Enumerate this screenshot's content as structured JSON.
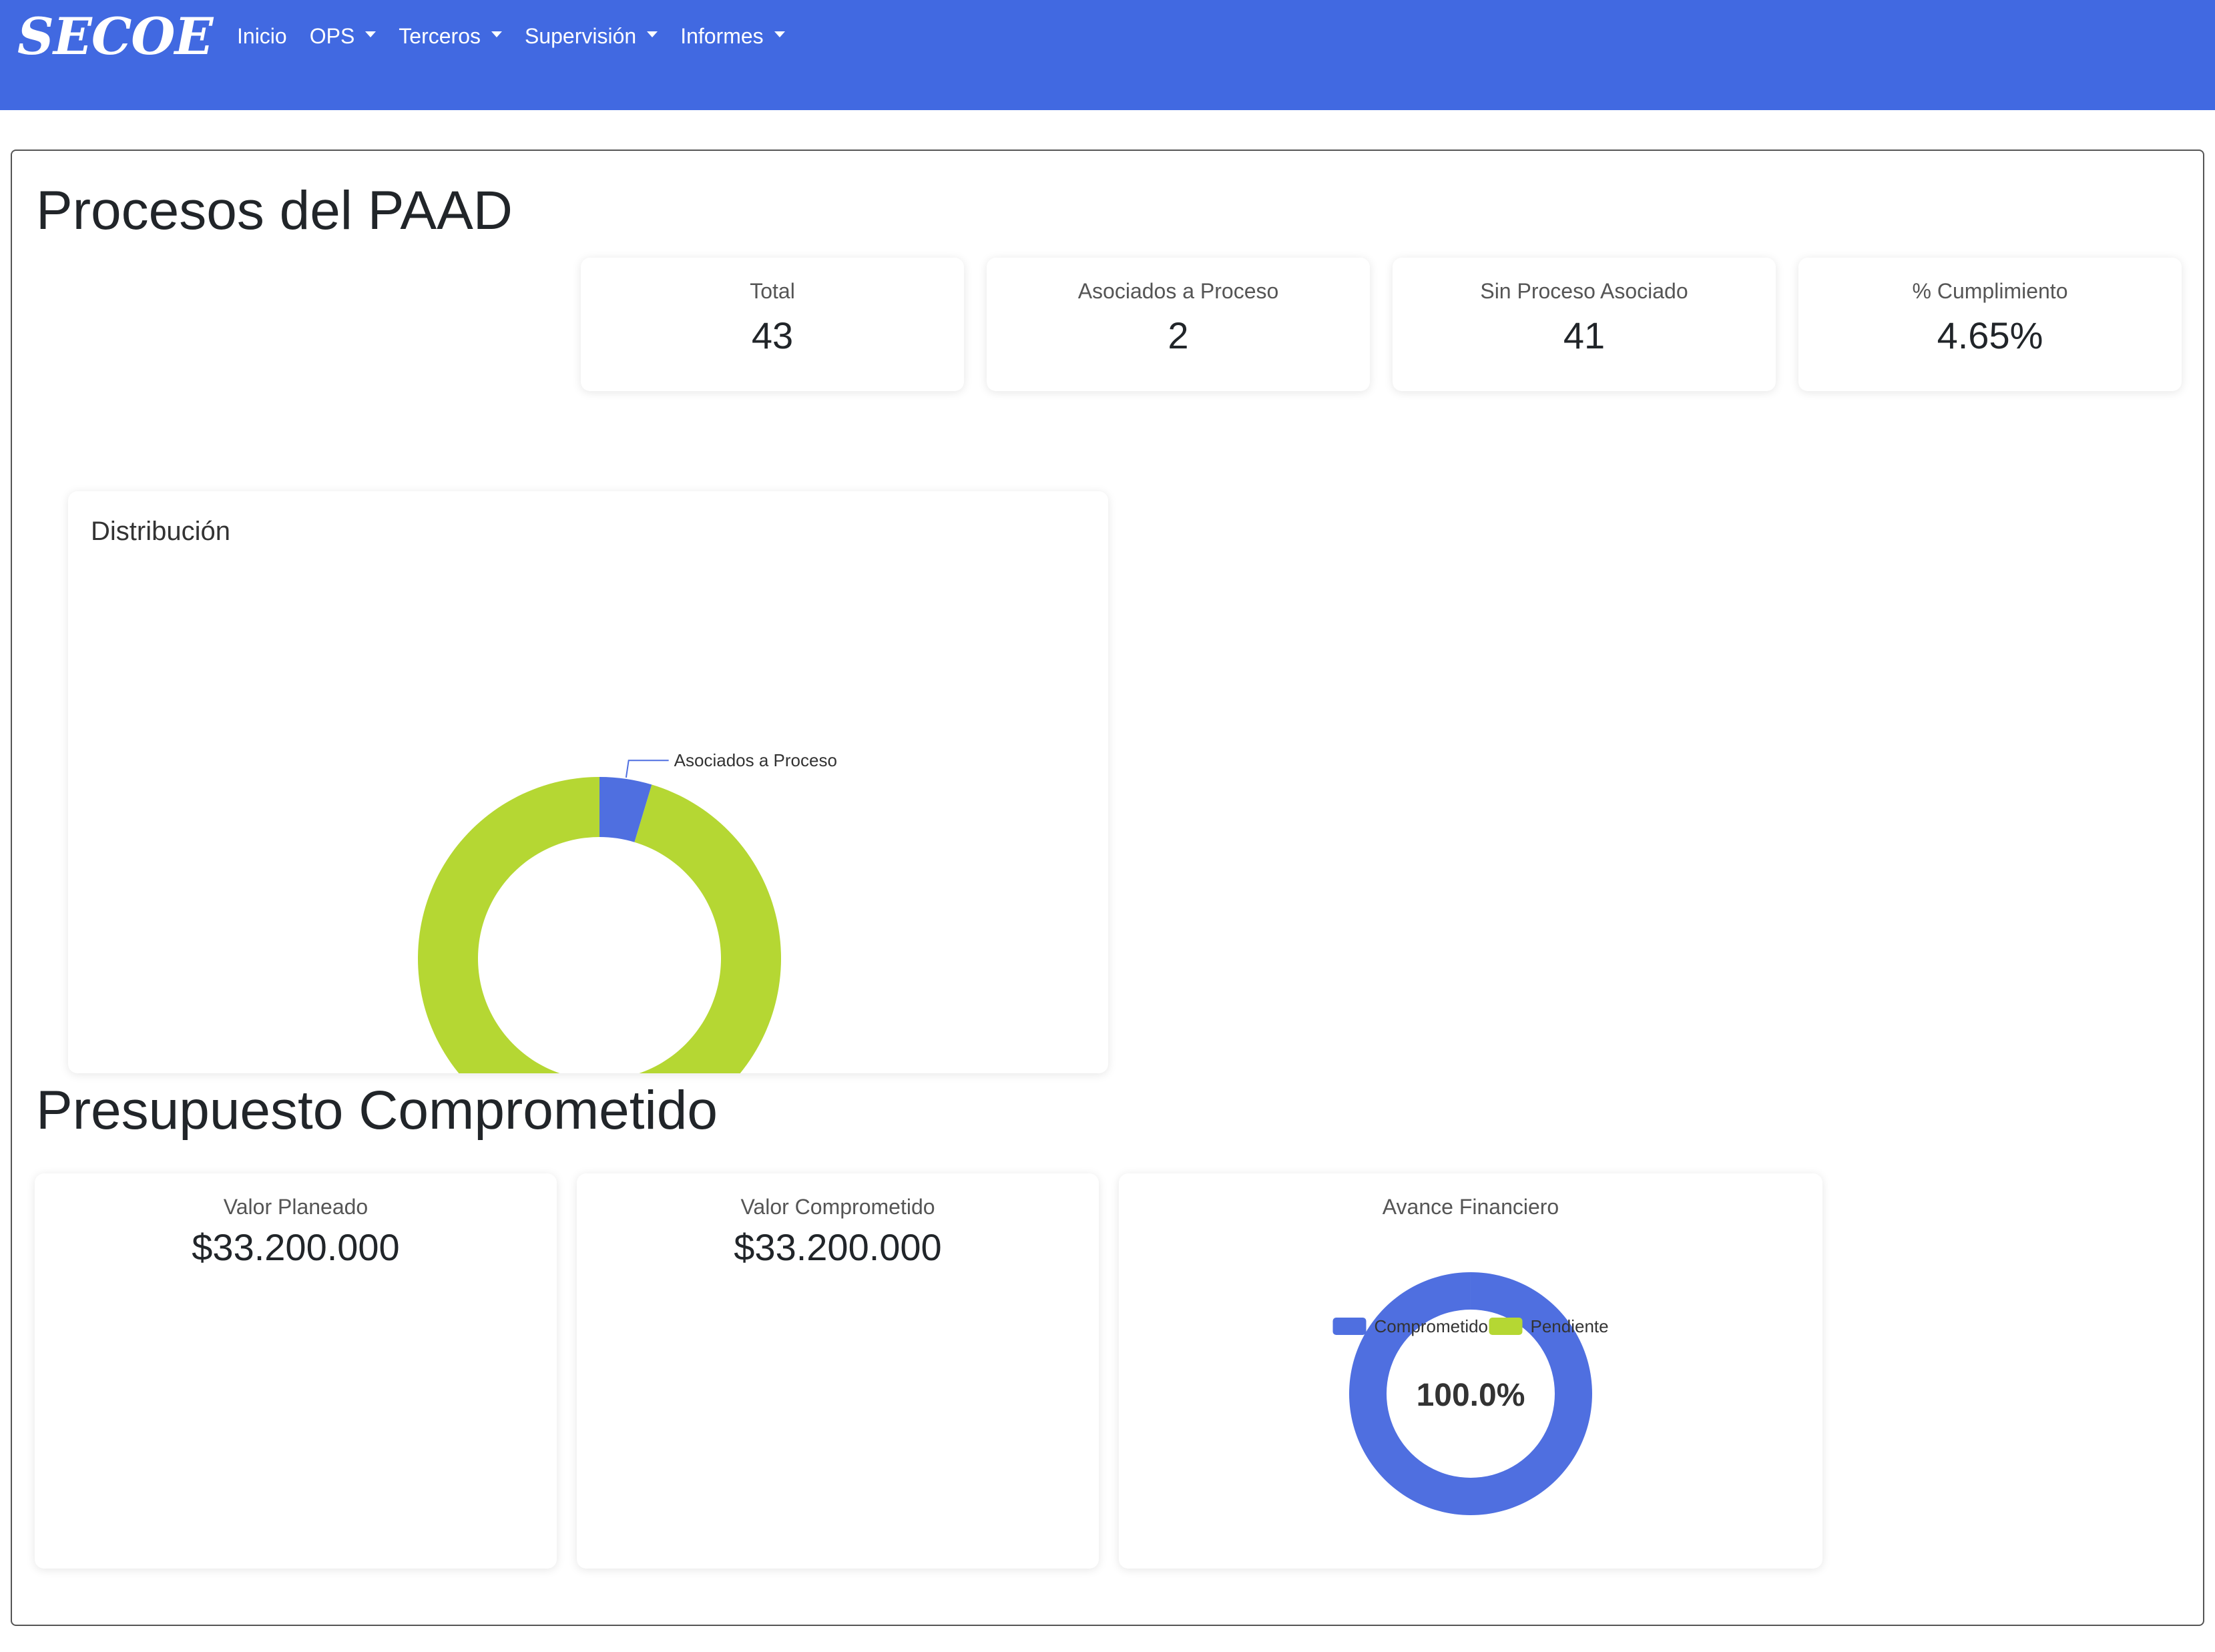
{
  "app": {
    "brand": "SECOE"
  },
  "nav": {
    "items": [
      {
        "label": "Inicio",
        "dropdown": false
      },
      {
        "label": "OPS",
        "dropdown": true
      },
      {
        "label": "Terceros",
        "dropdown": true
      },
      {
        "label": "Supervisión",
        "dropdown": true
      },
      {
        "label": "Informes",
        "dropdown": true
      }
    ]
  },
  "colors": {
    "navbar": "#4169e1",
    "series_blue": "#4f6fe0",
    "series_green": "#b5d733"
  },
  "paad": {
    "title": "Procesos del PAAD",
    "stats": [
      {
        "label": "Total",
        "value": "43"
      },
      {
        "label": "Asociados a Proceso",
        "value": "2"
      },
      {
        "label": "Sin Proceso Asociado",
        "value": "41"
      },
      {
        "label": "% Cumplimiento",
        "value": "4.65%"
      }
    ]
  },
  "distribution": {
    "title": "Distribución"
  },
  "budget": {
    "title": "Presupuesto Comprometido",
    "planned_label": "Valor Planeado",
    "planned_value": "$33.200.000",
    "committed_label": "Valor Comprometido",
    "committed_value": "$33.200.000",
    "progress_title": "Avance Financiero",
    "progress_center": "100.0%"
  },
  "chart_data": [
    {
      "type": "pie",
      "title": "Distribución",
      "categories": [
        "Asociados a Proceso",
        "Sin Proceso Asociado"
      ],
      "values": [
        2,
        41
      ],
      "colors": [
        "#4f6fe0",
        "#b5d733"
      ],
      "legend": "bottom"
    },
    {
      "type": "pie",
      "title": "Avance Financiero",
      "categories": [
        "Comprometido",
        "Pendiente"
      ],
      "values": [
        100,
        0
      ],
      "colors": [
        "#4f6fe0",
        "#b5d733"
      ],
      "center_label": "100.0%",
      "legend": "bottom"
    }
  ]
}
